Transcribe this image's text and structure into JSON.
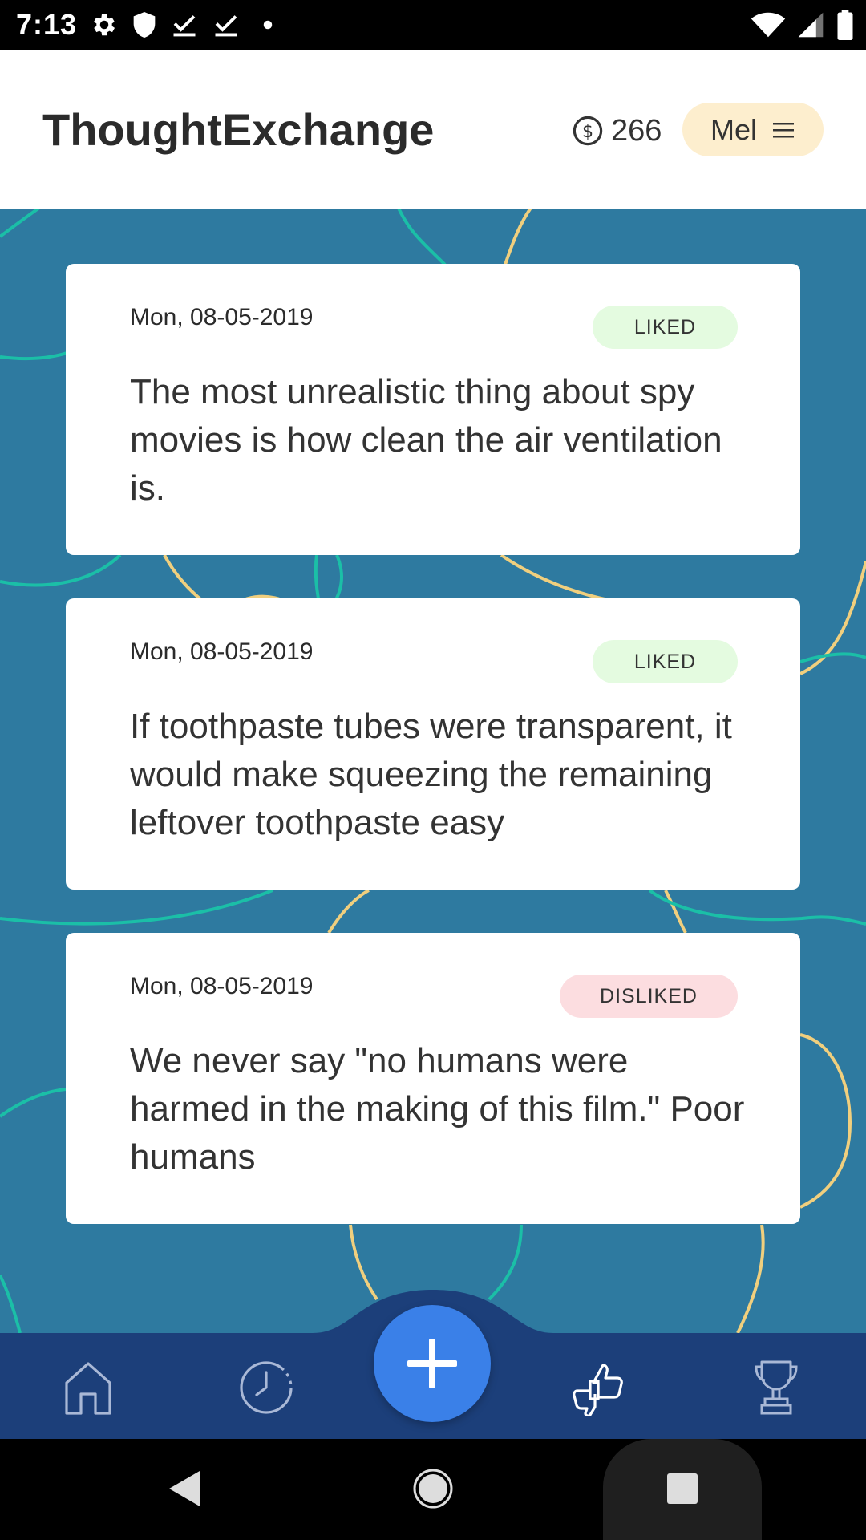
{
  "status_bar": {
    "time": "7:13",
    "left_icons": [
      "gear-icon",
      "shield-icon",
      "download-done-icon",
      "download-done-icon",
      "dot-icon"
    ],
    "right_icons": [
      "wifi-icon",
      "signal-icon",
      "battery-icon"
    ]
  },
  "header": {
    "title": "ThoughtExchange",
    "coin_icon": "dollar-coin-icon",
    "coins": "266",
    "user_name": "Mel",
    "menu_icon": "hamburger-icon"
  },
  "cards": [
    {
      "date": "Mon, 08-05-2019",
      "status": "LIKED",
      "text": "The most unrealistic thing about spy movies is how clean the air ventilation is."
    },
    {
      "date": "Mon, 08-05-2019",
      "status": "LIKED",
      "text": "If toothpaste tubes were transparent, it would make squeezing the remaining leftover toothpaste easy"
    },
    {
      "date": "Mon, 08-05-2019",
      "status": "DISLIKED",
      "text": "We never say \"no humans were harmed in the making of this film.\" Poor humans"
    }
  ],
  "bottom_nav": {
    "items": [
      "home-icon",
      "history-icon",
      "add-icon",
      "reactions-icon",
      "trophy-icon"
    ],
    "active": "reactions-icon"
  },
  "system_nav": [
    "back-icon",
    "home-circle-icon",
    "recents-icon"
  ],
  "colors": {
    "background": "#2e7aa0",
    "nav": "#1c3f7a",
    "fab": "#3a80e8",
    "liked_badge": "#e4fbe0",
    "disliked_badge": "#fcdde0",
    "user_chip": "#fdeece"
  }
}
